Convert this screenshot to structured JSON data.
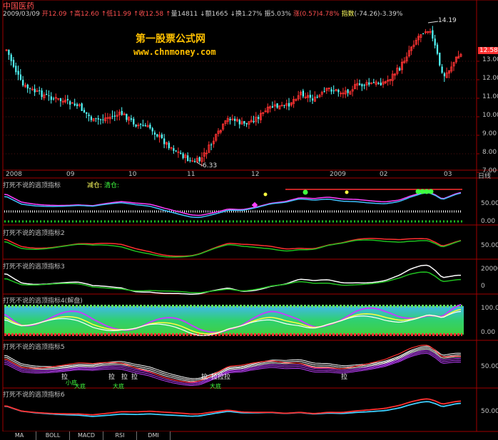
{
  "stock": {
    "name": "中国医药"
  },
  "quote": {
    "date": "2009/03/09",
    "open_label": "开",
    "open": "12.09",
    "high_label": "高",
    "high": "12.60",
    "low_label": "低",
    "low": "11.99",
    "close_label": "收",
    "close": "12.58",
    "volume_label": "量",
    "volume": "14811",
    "amount_label": "额",
    "amount": "1665",
    "turnover_label": "换",
    "turnover": "1.27%",
    "amplitude_label": "振",
    "amplitude": "5.03%",
    "change_label": "涨",
    "change": "(0.57)",
    "change_pct": "4.78%",
    "index_label": "指数",
    "index": "(-74.26)-3.39%"
  },
  "watermark": {
    "title": "第一股票公式网",
    "url": "www.chnmoney.com"
  },
  "price_axis": {
    "labels": [
      "13.00",
      "12.00",
      "11.00",
      "10.00",
      "9.00",
      "8.00",
      "7.00"
    ],
    "last": "12.58"
  },
  "annotations": {
    "high": "14.19",
    "low": "6.33"
  },
  "time_axis": {
    "labels": [
      "2008",
      "09",
      "10",
      "11",
      "12",
      "2009",
      "02",
      "03"
    ],
    "unit": "日线"
  },
  "panels": [
    {
      "title": "打死不说的逃顶指标",
      "extra1": "减仓:",
      "extra2": "清仓:",
      "axis": [
        "50.00",
        "0.00"
      ]
    },
    {
      "title": "打死不说的逃顶指标2",
      "axis": [
        "50.00"
      ]
    },
    {
      "title": "打死不说的逃顶指标3",
      "axis": [
        "20000",
        "0"
      ]
    },
    {
      "title": "打死不说的逃顶指标4(解盘)",
      "axis": [
        "100.00",
        "0.00"
      ]
    },
    {
      "title": "打死不说的逃顶指标5",
      "axis": [
        "50.00"
      ]
    },
    {
      "title": "打死不说的逃顶指标6",
      "axis": [
        "50.00"
      ]
    }
  ],
  "panel5_labels": [
    "拉",
    "小底",
    "大底",
    "拉",
    "拉",
    "拉",
    "大底",
    "拉",
    "拉拉拉",
    "大底",
    "拉"
  ],
  "tabs": [
    "MA",
    "BOLL",
    "MACD",
    "RSI",
    "DMI"
  ],
  "colors": {
    "up": "#ff3232",
    "down": "#54ffff",
    "axis": "#a00000",
    "label": "#c0c0c0"
  }
}
